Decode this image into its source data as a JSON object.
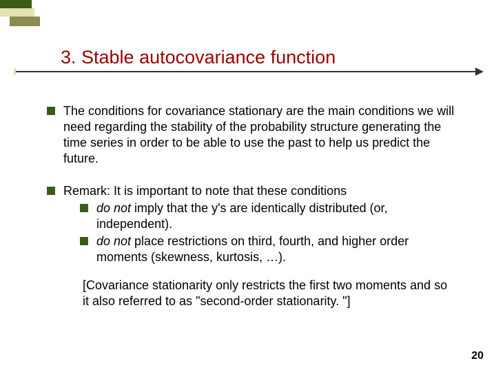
{
  "title": "3.  Stable autocovariance function",
  "bullets": {
    "b1": "The conditions for covariance stationary are the main conditions we will need regarding the stability of the probability structure generating the time series in order to be able to use the past to help us predict the future.",
    "b2_intro": "Remark: It is important to note that these conditions",
    "b2_sub1_em": "do not",
    "b2_sub1_rest": " imply that the y's are identically distributed (or, independent).",
    "b2_sub2_em": "do not",
    "b2_sub2_rest": " place restrictions on third, fourth, and higher order moments (skewness, kurtosis, …).",
    "note": "[Covariance stationarity only restricts the first two moments and so it also referred to as \"second-order stationarity. \"]"
  },
  "page_number": "20"
}
